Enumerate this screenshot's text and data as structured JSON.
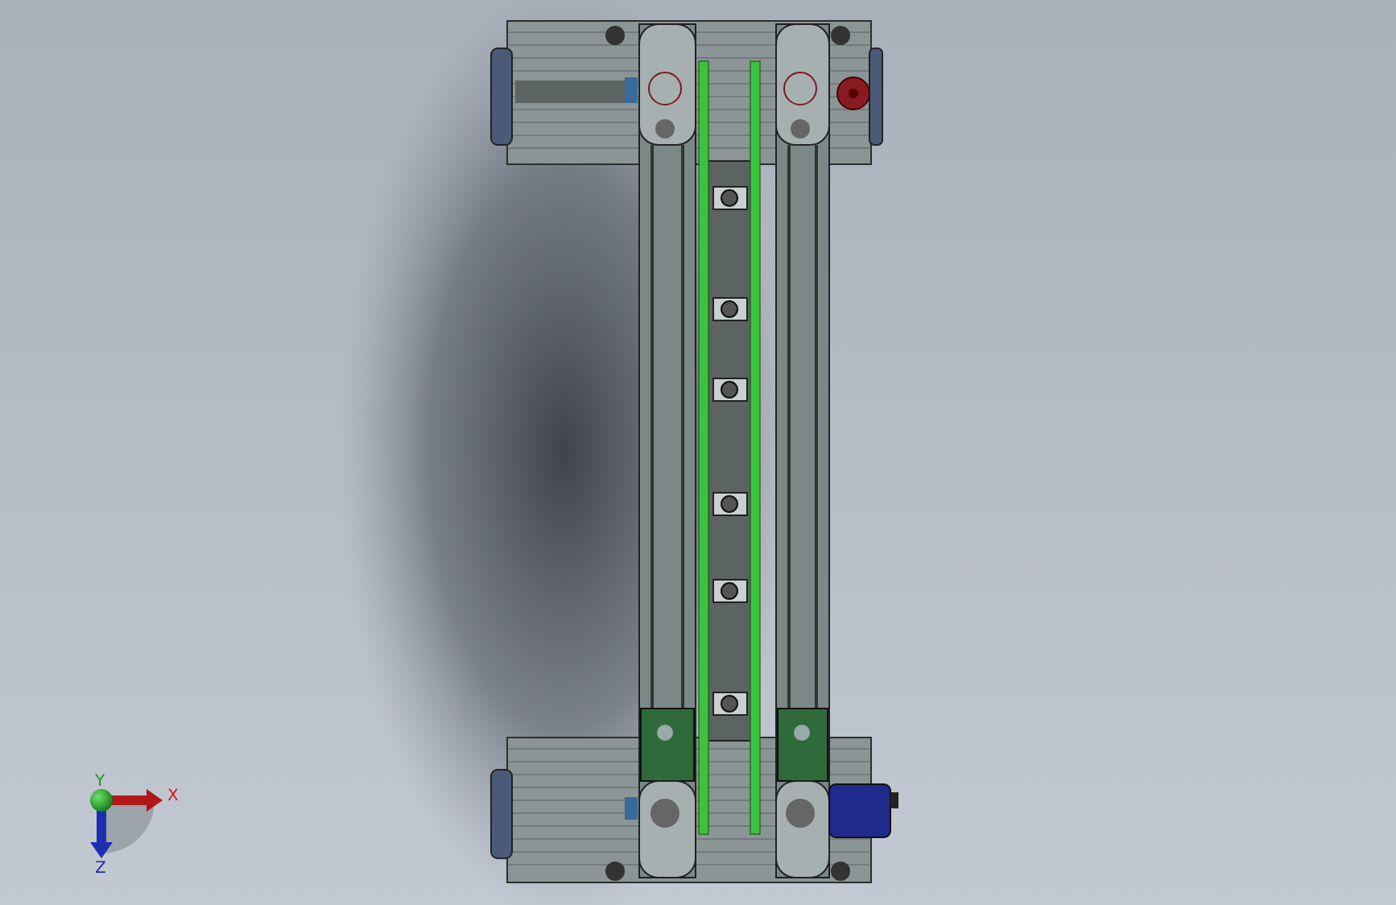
{
  "triad": {
    "x_label": "X",
    "y_label": "Y",
    "z_label": "Z"
  }
}
